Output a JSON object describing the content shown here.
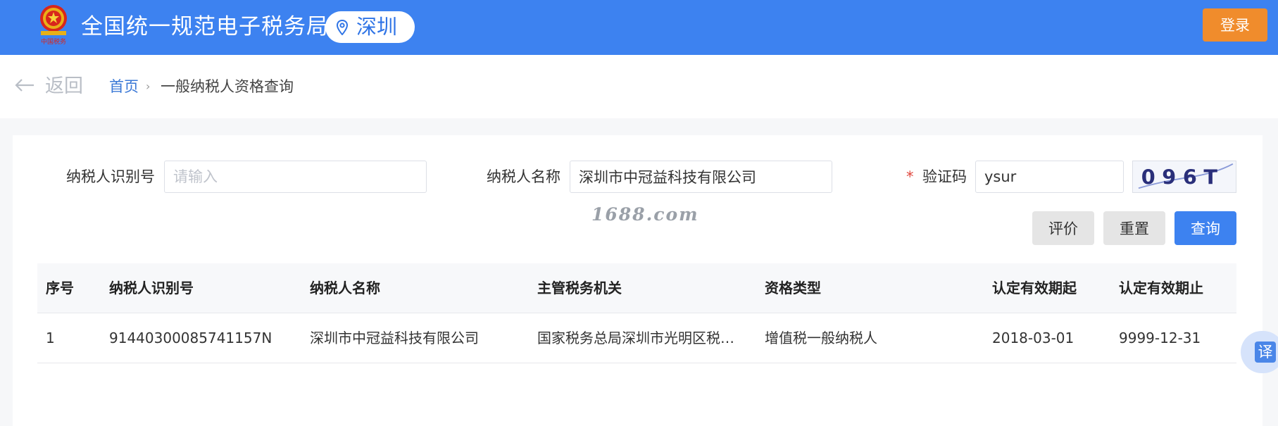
{
  "header": {
    "emblem_text": "中国税务",
    "title": "全国统一规范电子税务局",
    "city": "深圳",
    "login_label": "登录"
  },
  "nav": {
    "back_label": "返回",
    "breadcrumb_home": "首页",
    "breadcrumb_separator": "›",
    "breadcrumb_current": "一般纳税人资格查询"
  },
  "form": {
    "taxpayer_id_label": "纳税人识别号",
    "taxpayer_id_placeholder": "请输入",
    "taxpayer_id_value": "",
    "taxpayer_name_label": "纳税人名称",
    "taxpayer_name_value": "深圳市中冠益科技有限公司",
    "captcha_required_mark": "*",
    "captcha_label": "验证码",
    "captcha_value": "ysur",
    "captcha_image_text": "096T"
  },
  "watermark": "1688.com",
  "buttons": {
    "evaluate": "评价",
    "reset": "重置",
    "query": "查询"
  },
  "table": {
    "headers": [
      "序号",
      "纳税人识别号",
      "纳税人名称",
      "主管税务机关",
      "资格类型",
      "认定有效期起",
      "认定有效期止"
    ],
    "rows": [
      [
        "1",
        "91440300085741157N",
        "深圳市中冠益科技有限公司",
        "国家税务总局深圳市光明区税…",
        "增值税一般纳税人",
        "2018-03-01",
        "9999-12-31"
      ]
    ]
  },
  "float": {
    "translate_label": "译"
  },
  "colors": {
    "brand_blue": "#3d82f0",
    "login_orange": "#f08c2c",
    "link_blue": "#3a78d6",
    "required_red": "#e0463c"
  }
}
